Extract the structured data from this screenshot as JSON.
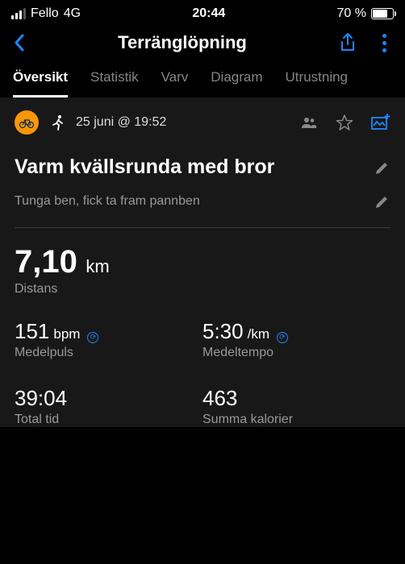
{
  "statusBar": {
    "carrier": "Fello",
    "network": "4G",
    "time": "20:44",
    "battery": "70 %"
  },
  "nav": {
    "title": "Terränglöpning"
  },
  "tabs": [
    {
      "label": "Översikt",
      "active": true
    },
    {
      "label": "Statistik",
      "active": false
    },
    {
      "label": "Varv",
      "active": false
    },
    {
      "label": "Diagram",
      "active": false
    },
    {
      "label": "Utrustning",
      "active": false
    }
  ],
  "activity": {
    "datetime": "25 juni @ 19:52",
    "title": "Varm kvällsrunda med bror",
    "description": "Tunga ben, fick ta fram pannben"
  },
  "distance": {
    "value": "7,10",
    "unit": "km",
    "label": "Distans"
  },
  "stats": {
    "avgHr": {
      "value": "151",
      "unit": "bpm",
      "label": "Medelpuls",
      "indicator": true
    },
    "avgPace": {
      "value": "5:30",
      "unit": "/km",
      "label": "Medeltempo",
      "indicator": true
    },
    "totalTime": {
      "value": "39:04",
      "unit": "",
      "label": "Total tid",
      "indicator": false
    },
    "calories": {
      "value": "463",
      "unit": "",
      "label": "Summa kalorier",
      "indicator": false
    }
  }
}
